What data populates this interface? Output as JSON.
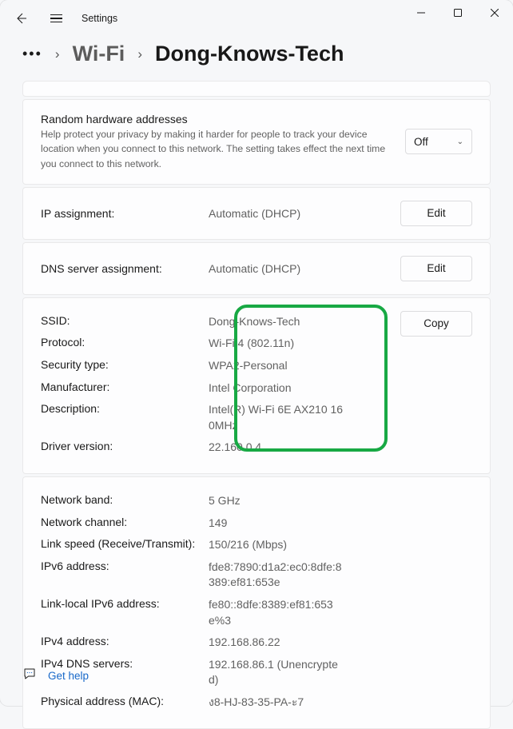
{
  "window": {
    "title": "Settings"
  },
  "breadcrumb": {
    "wifi": "Wi-Fi",
    "current": "Dong-Knows-Tech"
  },
  "random_hw": {
    "title": "Random hardware addresses",
    "desc": "Help protect your privacy by making it harder for people to track your device location when you connect to this network. The setting takes effect the next time you connect to this network.",
    "value": "Off"
  },
  "ip_assign": {
    "label": "IP assignment:",
    "value": "Automatic (DHCP)",
    "button": "Edit"
  },
  "dns_assign": {
    "label": "DNS server assignment:",
    "value": "Automatic (DHCP)",
    "button": "Edit"
  },
  "details1": {
    "copy_button": "Copy",
    "rows": [
      {
        "label": "SSID:",
        "value": "Dong-Knows-Tech"
      },
      {
        "label": "Protocol:",
        "value": "Wi-Fi 4 (802.11n)"
      },
      {
        "label": "Security type:",
        "value": "WPA2-Personal"
      },
      {
        "label": "Manufacturer:",
        "value": "Intel Corporation"
      },
      {
        "label": "Description:",
        "value": "Intel(R) Wi-Fi 6E AX210 160MHz"
      },
      {
        "label": "Driver version:",
        "value": "22.160.0.4"
      }
    ]
  },
  "details2": {
    "rows": [
      {
        "label": "Network band:",
        "value": "5 GHz"
      },
      {
        "label": "Network channel:",
        "value": "149"
      },
      {
        "label": "Link speed (Receive/Transmit):",
        "value": "150/216 (Mbps)"
      },
      {
        "label": "IPv6 address:",
        "value": "fde8:7890:d1a2:ec0:8dfe:8389:ef81:653e"
      },
      {
        "label": "Link-local IPv6 address:",
        "value": "fe80::8dfe:8389:ef81:653e%3"
      },
      {
        "label": "IPv4 address:",
        "value": "192.168.86.22"
      },
      {
        "label": "IPv4 DNS servers:",
        "value": "192.168.86.1 (Unencrypted)"
      },
      {
        "label": "Physical address (MAC):",
        "value": "ง8-HJ-83-35-PA-ะ7"
      }
    ]
  },
  "help": {
    "label": "Get help"
  }
}
